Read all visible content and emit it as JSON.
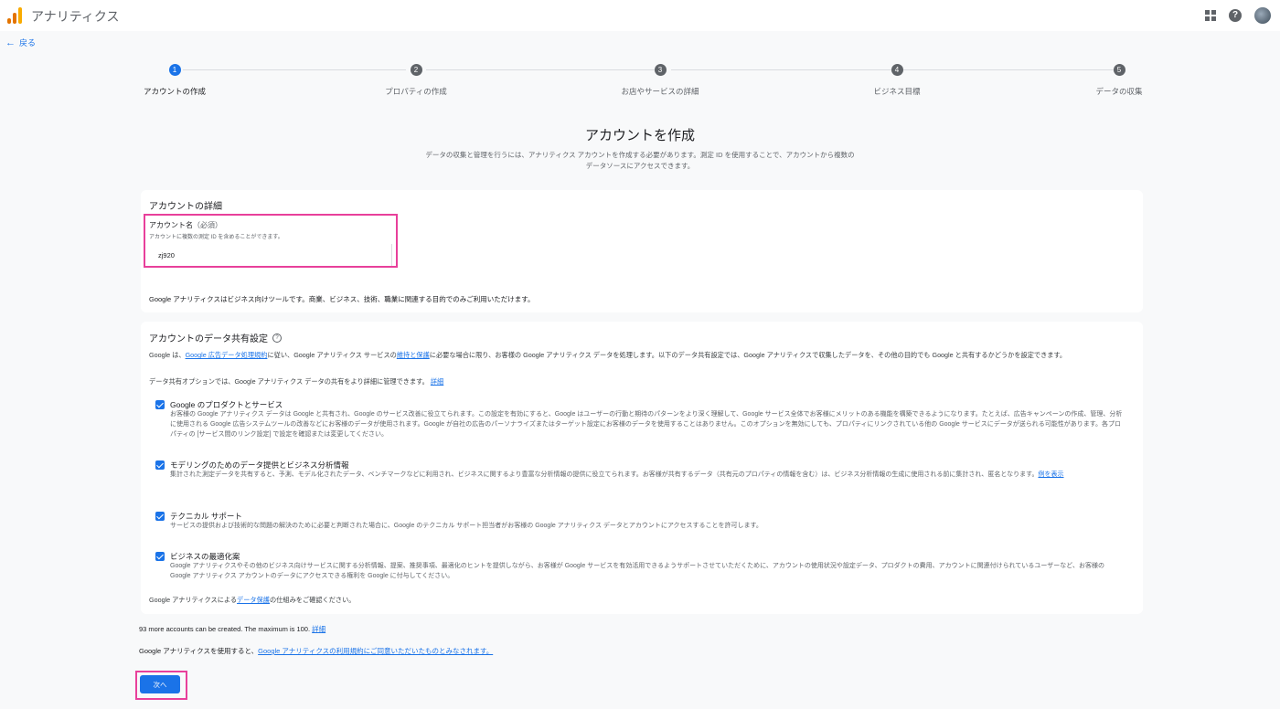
{
  "header": {
    "app_title": "アナリティクス"
  },
  "nav": {
    "back_label": "戻る"
  },
  "steps": [
    {
      "num": "1",
      "label": "アカウントの作成"
    },
    {
      "num": "2",
      "label": "プロパティの作成"
    },
    {
      "num": "3",
      "label": "お店やサービスの詳細"
    },
    {
      "num": "4",
      "label": "ビジネス目標"
    },
    {
      "num": "5",
      "label": "データの収集"
    }
  ],
  "page": {
    "title": "アカウントを作成",
    "description": "データの収集と管理を行うには、アナリティクス アカウントを作成する必要があります。測定 ID を使用することで、アカウントから複数のデータソースにアクセスできます。"
  },
  "account_details": {
    "title": "アカウントの詳細",
    "field_label": "アカウント名",
    "field_required": "（必須）",
    "field_hint": "アカウントに複数の測定 ID を含めることができます。",
    "field_value": "zj920",
    "note": "Google アナリティクスはビジネス向けツールです。商業、ビジネス、技術、職業に関連する目的でのみご利用いただけます。"
  },
  "data_sharing": {
    "title": "アカウントのデータ共有設定",
    "intro_1": "Google は、",
    "intro_link_1": "Google 広告データ処理規約",
    "intro_2": "に従い、Google アナリティクス サービスの",
    "intro_link_2": "維持と保護",
    "intro_3": "に必要な場合に限り、お客様の Google アナリティクス データを処理します。以下のデータ共有設定では、Google アナリティクスで収集したデータを、その他の目的でも Google と共有するかどうかを設定できます。",
    "options_text": "データ共有オプションでは、Google アナリティクス データの共有をより詳細に管理できます。",
    "options_link": "詳細",
    "options": [
      {
        "title": "Google のプロダクトとサービス",
        "desc": "お客様の Google アナリティクス データは Google と共有され、Google のサービス改善に役立てられます。この設定を有効にすると、Google はユーザーの行動と期待のパターンをより深く理解して、Google サービス全体でお客様にメリットのある機能を構築できるようになります。たとえば、広告キャンペーンの作成、管理、分析に使用される Google 広告システムツールの改善などにお客様のデータが使用されます。Google が自社の広告のパーソナライズまたはターゲット設定にお客様のデータを使用することはありません。このオプションを無効にしても、プロパティにリンクされている他の Google サービスにデータが送られる可能性があります。各プロパティの [サービス間のリンク設定] で設定を確認または変更してください。",
        "link": ""
      },
      {
        "title": "モデリングのためのデータ提供とビジネス分析情報",
        "desc": "集計された測定データを共有すると、予測、モデル化されたデータ、ベンチマークなどに利用され、ビジネスに関するより豊富な分析情報の提供に役立てられます。お客様が共有するデータ（共有元のプロパティの情報を含む）は、ビジネス分析情報の生成に使用される前に集計され、匿名となります。",
        "link": "例を表示"
      },
      {
        "title": "テクニカル サポート",
        "desc": "サービスの提供および技術的な問題の解決のために必要と判断された場合に、Google のテクニカル サポート担当者がお客様の Google アナリティクス データとアカウントにアクセスすることを許可します。",
        "link": ""
      },
      {
        "title": "ビジネスの最適化案",
        "desc": "Google アナリティクスやその他のビジネス向けサービスに関する分析情報、提案、推奨事項、最適化のヒントを提供しながら、お客様が Google サービスを有効活用できるようサポートさせていただくために、アカウントの使用状況や設定データ、プロダクトの費用、アカウントに関連付けられているユーザーなど、お客様の Google アナリティクス アカウントのデータにアクセスできる権利を Google に付与してください。",
        "link": ""
      }
    ],
    "protect_1": "Google アナリティクスによる",
    "protect_link": "データ保護",
    "protect_2": "の仕組みをご確認ください。"
  },
  "footer": {
    "accounts_text": "93 more accounts can be created. The maximum is 100.",
    "accounts_link": "詳細",
    "terms_text": "Google アナリティクスを使用すると、",
    "terms_link": "Google アナリティクスの利用規約にご同意いただいたものとみなされます。",
    "next_label": "次へ"
  }
}
